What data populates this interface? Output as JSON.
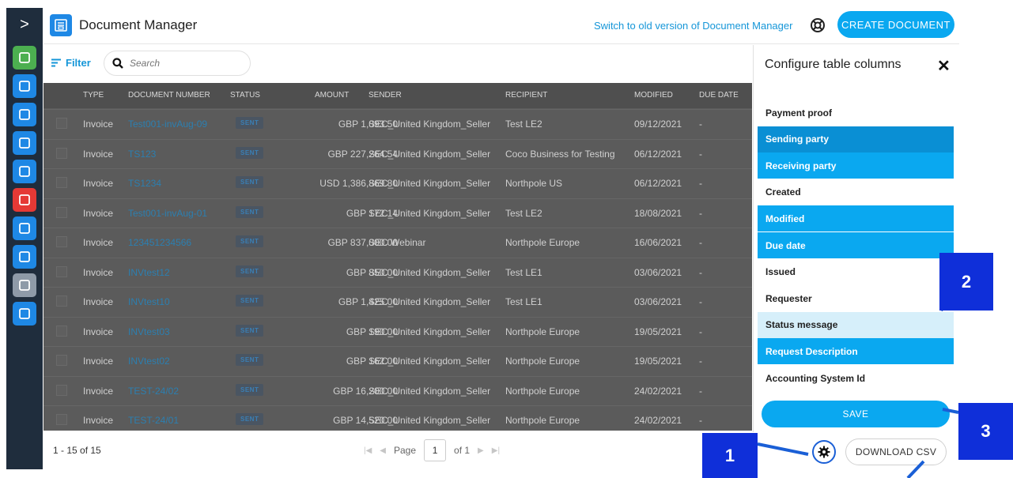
{
  "app": {
    "title": "Document Manager",
    "switch_link": "Switch to old version of Document Manager",
    "create_button": "CREATE DOCUMENT"
  },
  "nav": {
    "expander": ">",
    "icons": [
      {
        "name": "add-icon",
        "color": "#4caf50"
      },
      {
        "name": "document-manager-icon",
        "color": "#1e88e5"
      },
      {
        "name": "hierarchy-icon",
        "color": "#1e88e5"
      },
      {
        "name": "support-icon",
        "color": "#1e88e5"
      },
      {
        "name": "dashboard-icon",
        "color": "#1e88e5"
      },
      {
        "name": "education-icon",
        "color": "#e53935"
      },
      {
        "name": "global-settings-icon",
        "color": "#1e88e5"
      },
      {
        "name": "building-icon",
        "color": "#1e88e5"
      },
      {
        "name": "apps-grid-icon",
        "color": "#8e9aa8"
      },
      {
        "name": "book-icon",
        "color": "#1e88e5"
      }
    ]
  },
  "filterbar": {
    "filter_label": "Filter",
    "search_placeholder": "Search"
  },
  "table": {
    "headers": [
      "TYPE",
      "DOCUMENT NUMBER",
      "STATUS",
      "AMOUNT",
      "SENDER",
      "RECIPIENT",
      "MODIFIED",
      "DUE DATE"
    ],
    "rows": [
      {
        "type": "Invoice",
        "number": "Test001-invAug-09",
        "status": "SENT",
        "amount": "GBP 1,093.50",
        "sender": "SEC_United Kingdom_Seller",
        "recipient": "Test LE2",
        "modified": "09/12/2021",
        "due": "-"
      },
      {
        "type": "Invoice",
        "number": "TS123",
        "status": "SENT",
        "amount": "GBP 227,264.54",
        "sender": "SEC_United Kingdom_Seller",
        "recipient": "Coco Business for Testing",
        "modified": "06/12/2021",
        "due": "-"
      },
      {
        "type": "Invoice",
        "number": "TS1234",
        "status": "SENT",
        "amount": "USD 1,386,869.80",
        "sender": "SEC_United Kingdom_Seller",
        "recipient": "Northpole US",
        "modified": "06/12/2021",
        "due": "-"
      },
      {
        "type": "Invoice",
        "number": "Test001-invAug-01",
        "status": "SENT",
        "amount": "GBP 172.14",
        "sender": "SEC_United Kingdom_Seller",
        "recipient": "Test LE2",
        "modified": "18/08/2021",
        "due": "-"
      },
      {
        "type": "Invoice",
        "number": "123451234566",
        "status": "SENT",
        "amount": "GBP 837,000.00",
        "sender": "SEC Webinar",
        "recipient": "Northpole Europe",
        "modified": "16/06/2021",
        "due": "-"
      },
      {
        "type": "Invoice",
        "number": "INVtest12",
        "status": "SENT",
        "amount": "GBP 850.00",
        "sender": "SEC_United Kingdom_Seller",
        "recipient": "Test LE1",
        "modified": "03/06/2021",
        "due": "-"
      },
      {
        "type": "Invoice",
        "number": "INVtest10",
        "status": "SENT",
        "amount": "GBP 1,425.00",
        "sender": "SEC_United Kingdom_Seller",
        "recipient": "Test LE1",
        "modified": "03/06/2021",
        "due": "-"
      },
      {
        "type": "Invoice",
        "number": "INVtest03",
        "status": "SENT",
        "amount": "GBP 190.00",
        "sender": "SEC_United Kingdom_Seller",
        "recipient": "Northpole Europe",
        "modified": "19/05/2021",
        "due": "-"
      },
      {
        "type": "Invoice",
        "number": "INVtest02",
        "status": "SENT",
        "amount": "GBP 162.00",
        "sender": "SEC_United Kingdom_Seller",
        "recipient": "Northpole Europe",
        "modified": "19/05/2021",
        "due": "-"
      },
      {
        "type": "Invoice",
        "number": "TEST-24/02",
        "status": "SENT",
        "amount": "GBP 16,200.00",
        "sender": "SEC_United Kingdom_Seller",
        "recipient": "Northpole Europe",
        "modified": "24/02/2021",
        "due": "-"
      },
      {
        "type": "Invoice",
        "number": "TEST-24/01",
        "status": "SENT",
        "amount": "GBP 14,520.00",
        "sender": "SEC_United Kingdom_Seller",
        "recipient": "Northpole Europe",
        "modified": "24/02/2021",
        "due": "-"
      }
    ]
  },
  "footer": {
    "count": "1 - 15 of 15",
    "page_label": "Page",
    "page_value": "1",
    "of_label": "of 1",
    "csv_button": "DOWNLOAD CSV"
  },
  "panel": {
    "title": "Configure table columns",
    "columns": [
      {
        "label": "Payment proof",
        "state": "off"
      },
      {
        "label": "Sending party",
        "state": "dark"
      },
      {
        "label": "Receiving party",
        "state": "on"
      },
      {
        "label": "Created",
        "state": "off"
      },
      {
        "label": "Modified",
        "state": "on"
      },
      {
        "label": "Due date",
        "state": "on"
      },
      {
        "label": "Issued",
        "state": "off"
      },
      {
        "label": "Requester",
        "state": "off"
      },
      {
        "label": "Status message",
        "state": "hover"
      },
      {
        "label": "Request Description",
        "state": "on"
      },
      {
        "label": "Accounting System Id",
        "state": "off"
      }
    ],
    "save_button": "SAVE"
  },
  "callouts": {
    "one": "1",
    "two": "2",
    "three": "3"
  },
  "colors": {
    "accent": "#0aa8f0",
    "callout": "#0f2fd9",
    "nav_bg": "#1f2d3d"
  }
}
